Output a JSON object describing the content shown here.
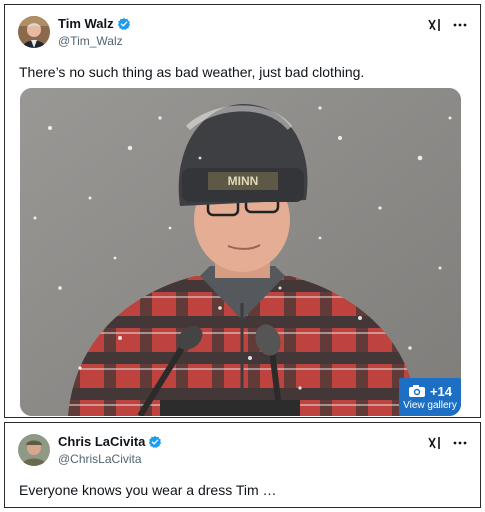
{
  "tweets": [
    {
      "author": {
        "name": "Tim Walz",
        "handle": "@Tim_Walz"
      },
      "text": "There’s no such thing as bad weather, just bad clothing.",
      "media": {
        "gallery_count": "+14",
        "gallery_label": "View gallery",
        "hat_text": "MINN"
      }
    },
    {
      "author": {
        "name": "Chris LaCivita",
        "handle": "@ChrisLaCivita"
      },
      "text": "Everyone knows you wear a dress Tim …"
    }
  ],
  "colors": {
    "verified": "#1d9bf0",
    "gallery": "#1d6fc4",
    "handle": "#536471"
  },
  "icons": [
    "verified-badge-icon",
    "grok-icon",
    "more-icon",
    "camera-icon"
  ]
}
